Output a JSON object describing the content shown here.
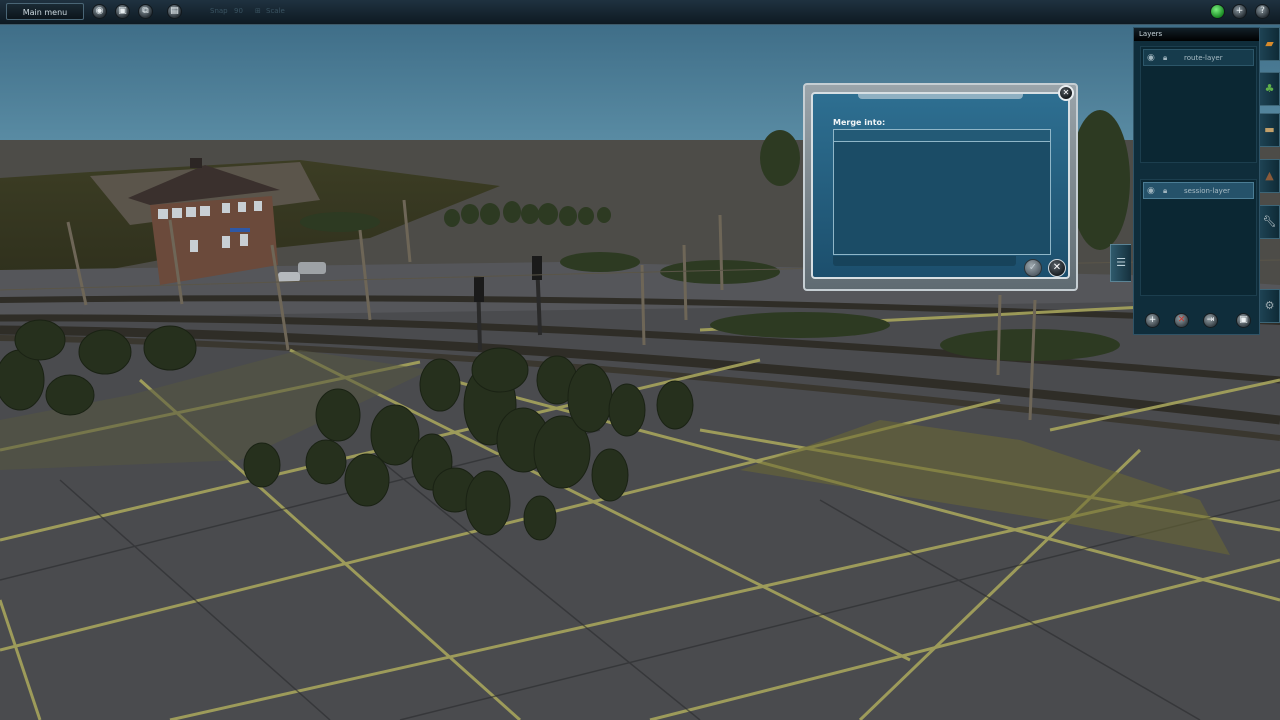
{
  "toolbar": {
    "main_menu_label": "Main menu",
    "snap_label": "Snap",
    "snap_value": "90",
    "mode_label": "Scale",
    "icons": [
      "globe-icon",
      "save-icon",
      "copy-icon",
      "document-icon"
    ],
    "right_icons": [
      "status-indicator-icon",
      "add-icon",
      "help-icon"
    ],
    "help_glyph": "?",
    "add_glyph": "+"
  },
  "layers_panel": {
    "title": "Layers",
    "route_layers": [
      {
        "name": "route-layer",
        "visible": true,
        "locked": true
      }
    ],
    "session_layers": [
      {
        "name": "session-layer",
        "visible": true,
        "locked": true,
        "selected": true
      }
    ],
    "buttons": [
      "add-layer-icon",
      "delete-layer-icon",
      "merge-layer-icon",
      "save-layer-icon"
    ]
  },
  "merge_dialog": {
    "label": "Merge into:",
    "items": []
  },
  "colors": {
    "sky": "#4a7a93",
    "ground": "#4c4d4f",
    "grid_lines": "#a6a45c",
    "panel_bg": "#0f2d3b",
    "dialog_blue": "#2e6f91",
    "status_green": "#2fbf3a"
  }
}
